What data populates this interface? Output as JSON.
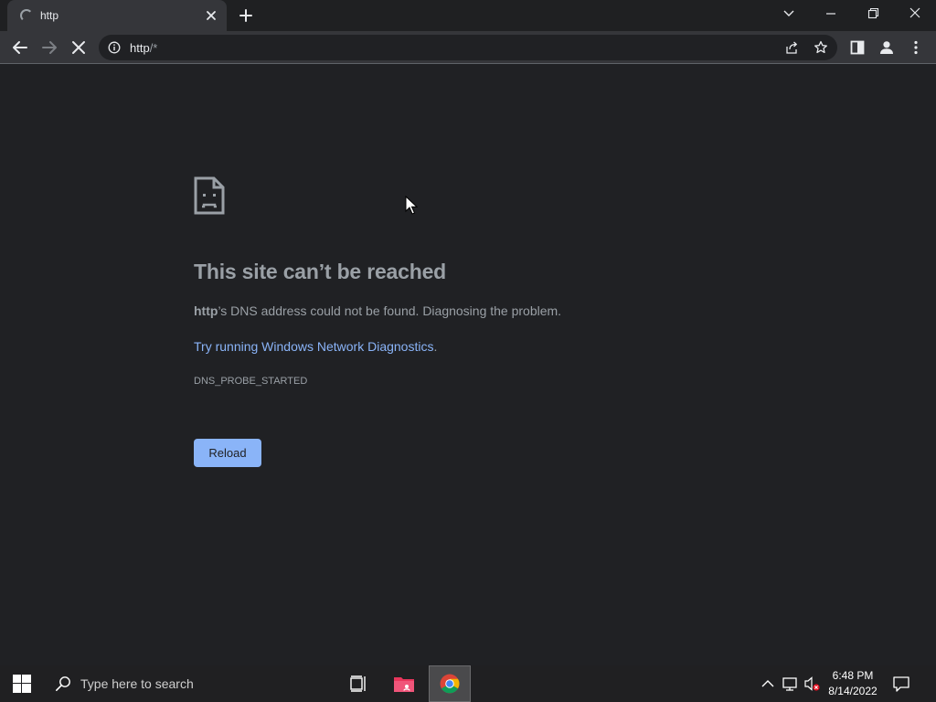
{
  "tab": {
    "title": "http"
  },
  "address_bar": {
    "url_main": "http",
    "url_suffix": "/*"
  },
  "error_page": {
    "title": "This site can’t be reached",
    "host": "http",
    "message_rest": "’s DNS address could not be found. Diagnosing the problem.",
    "link_text": "Try running Windows Network Diagnostics",
    "link_punct": ".",
    "error_code": "DNS_PROBE_STARTED",
    "reload_label": "Reload"
  },
  "taskbar": {
    "search_placeholder": "Type here to search",
    "time": "6:48 PM",
    "date": "8/14/2022"
  },
  "colors": {
    "page_bg": "#202124",
    "toolbar_bg": "#35363a",
    "link": "#8ab4f8",
    "button_bg": "#8ab4f8",
    "text_secondary": "#9aa0a6"
  },
  "icons": [
    "loading-spinner-icon",
    "close-icon",
    "plus-icon",
    "chevron-down-icon",
    "minimize-icon",
    "restore-icon",
    "back-arrow-icon",
    "forward-arrow-icon",
    "stop-icon",
    "info-icon",
    "share-icon",
    "star-icon",
    "side-panel-icon",
    "profile-icon",
    "kebab-menu-icon",
    "sad-page-icon",
    "windows-logo-icon",
    "search-icon",
    "task-view-icon",
    "file-explorer-icon",
    "chrome-icon",
    "chevron-up-icon",
    "network-icon",
    "volume-muted-icon",
    "notification-icon"
  ]
}
